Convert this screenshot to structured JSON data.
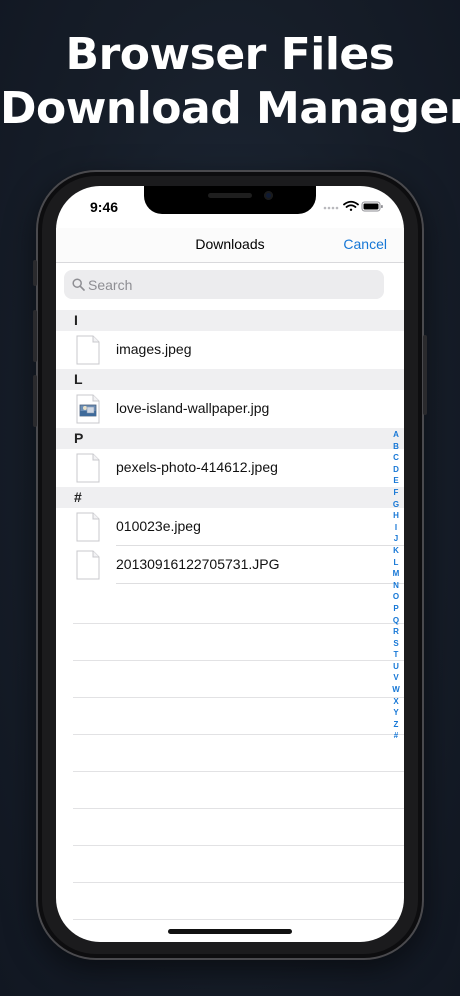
{
  "headline": {
    "line1": "Browser Files",
    "line2": "Download Manager"
  },
  "status_bar": {
    "time": "9:46"
  },
  "nav": {
    "title": "Downloads",
    "cancel_label": "Cancel"
  },
  "search": {
    "placeholder": "Search",
    "value": ""
  },
  "sections": [
    {
      "letter": "I",
      "items": [
        {
          "name": "images.jpeg",
          "icon": "blank-document-icon"
        }
      ]
    },
    {
      "letter": "L",
      "items": [
        {
          "name": "love-island-wallpaper.jpg",
          "icon": "image-document-icon"
        }
      ]
    },
    {
      "letter": "P",
      "items": [
        {
          "name": "pexels-photo-414612.jpeg",
          "icon": "blank-document-icon"
        }
      ]
    },
    {
      "letter": "#",
      "items": [
        {
          "name": "010023e.jpeg",
          "icon": "blank-document-icon"
        },
        {
          "name": "20130916122705731.JPG",
          "icon": "blank-document-icon"
        }
      ]
    }
  ],
  "index_letters": [
    "A",
    "B",
    "C",
    "D",
    "E",
    "F",
    "G",
    "H",
    "I",
    "J",
    "K",
    "L",
    "M",
    "N",
    "O",
    "P",
    "Q",
    "R",
    "S",
    "T",
    "U",
    "V",
    "W",
    "X",
    "Y",
    "Z",
    "#"
  ],
  "colors": {
    "accent": "#1677d6",
    "background": "#161d28",
    "section_header": "#efeff1"
  }
}
